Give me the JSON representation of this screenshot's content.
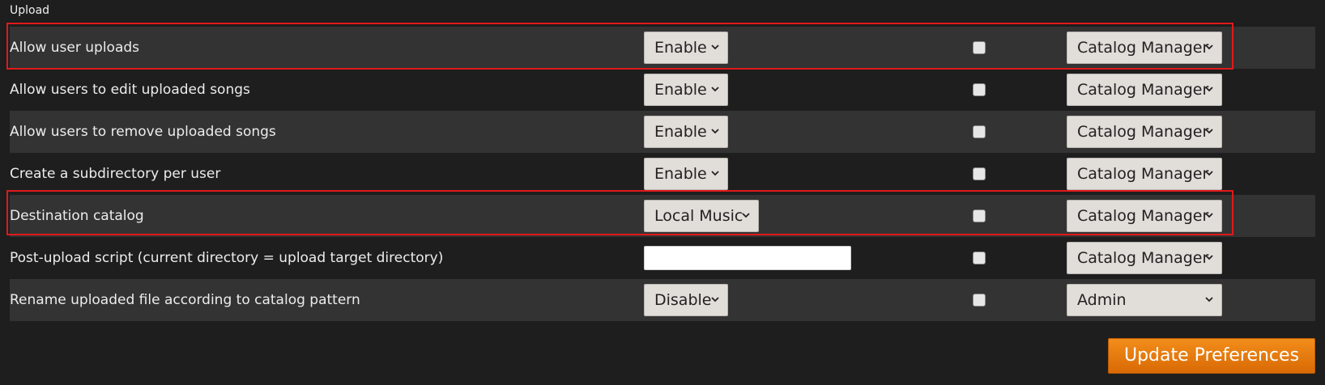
{
  "section": {
    "title": "Upload"
  },
  "rows": [
    {
      "label": "Allow user uploads",
      "value_type": "select",
      "value": "Enable",
      "apply_all": false,
      "access_level": "Catalog Manager",
      "highlighted": true
    },
    {
      "label": "Allow users to edit uploaded songs",
      "value_type": "select",
      "value": "Enable",
      "apply_all": false,
      "access_level": "Catalog Manager",
      "highlighted": false
    },
    {
      "label": "Allow users to remove uploaded songs",
      "value_type": "select",
      "value": "Enable",
      "apply_all": false,
      "access_level": "Catalog Manager",
      "highlighted": false
    },
    {
      "label": "Create a subdirectory per user",
      "value_type": "select",
      "value": "Enable",
      "apply_all": false,
      "access_level": "Catalog Manager",
      "highlighted": false
    },
    {
      "label": "Destination catalog",
      "value_type": "select",
      "value": "Local Music",
      "apply_all": false,
      "access_level": "Catalog Manager",
      "highlighted": true
    },
    {
      "label": "Post-upload script (current directory = upload target directory)",
      "value_type": "text",
      "value": "",
      "apply_all": false,
      "access_level": "Catalog Manager",
      "highlighted": false
    },
    {
      "label": "Rename uploaded file according to catalog pattern",
      "value_type": "select",
      "value": "Disable",
      "apply_all": false,
      "access_level": "Admin",
      "highlighted": false
    }
  ],
  "actions": {
    "update_label": "Update Preferences"
  },
  "colors": {
    "highlight": "#e0191b",
    "button": "#e67a0e"
  }
}
